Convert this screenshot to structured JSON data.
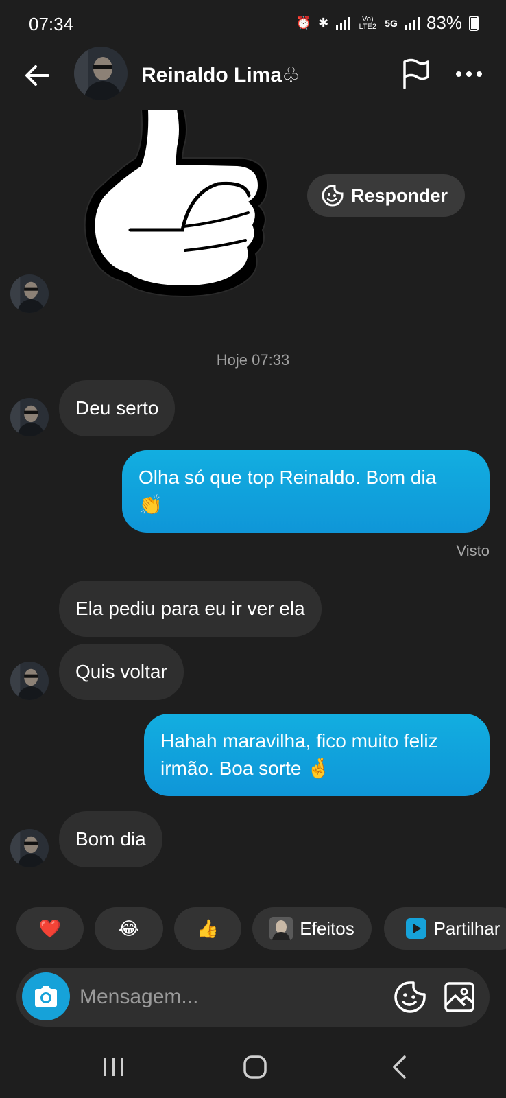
{
  "status_bar": {
    "time": "07:34",
    "network": "5G",
    "volte": "Vo) LTE2",
    "battery": "83%"
  },
  "header": {
    "contact_name": "Reinaldo Lima♧"
  },
  "sticker": {
    "reply_label": "Responder"
  },
  "chat": {
    "timestamp": "Hoje 07:33",
    "messages": [
      {
        "from": "them",
        "text": "Deu serto"
      },
      {
        "from": "me",
        "line1": "Olha só que top Reinaldo. Bom dia",
        "line2": "👏"
      },
      {
        "from": "them",
        "text": "Ela pediu para eu ir ver ela"
      },
      {
        "from": "them",
        "text": "Quis voltar"
      },
      {
        "from": "me",
        "line1": "Hahah maravilha, fico muito feliz",
        "line2": "irmão. Boa sorte 🤞"
      },
      {
        "from": "them",
        "text": "Bom dia"
      }
    ],
    "seen_label": "Visto"
  },
  "quick_reactions": {
    "heart": "❤️",
    "laugh": "😂",
    "thumbs": "👍",
    "effects_label": "Efeitos",
    "share_label": "Partilhar"
  },
  "composer": {
    "placeholder": "Mensagem..."
  },
  "colors": {
    "background": "#1e1e1e",
    "incoming_bubble": "#2f2f2f",
    "outgoing_bubble": "#12aee0",
    "accent": "#16a2d9"
  }
}
